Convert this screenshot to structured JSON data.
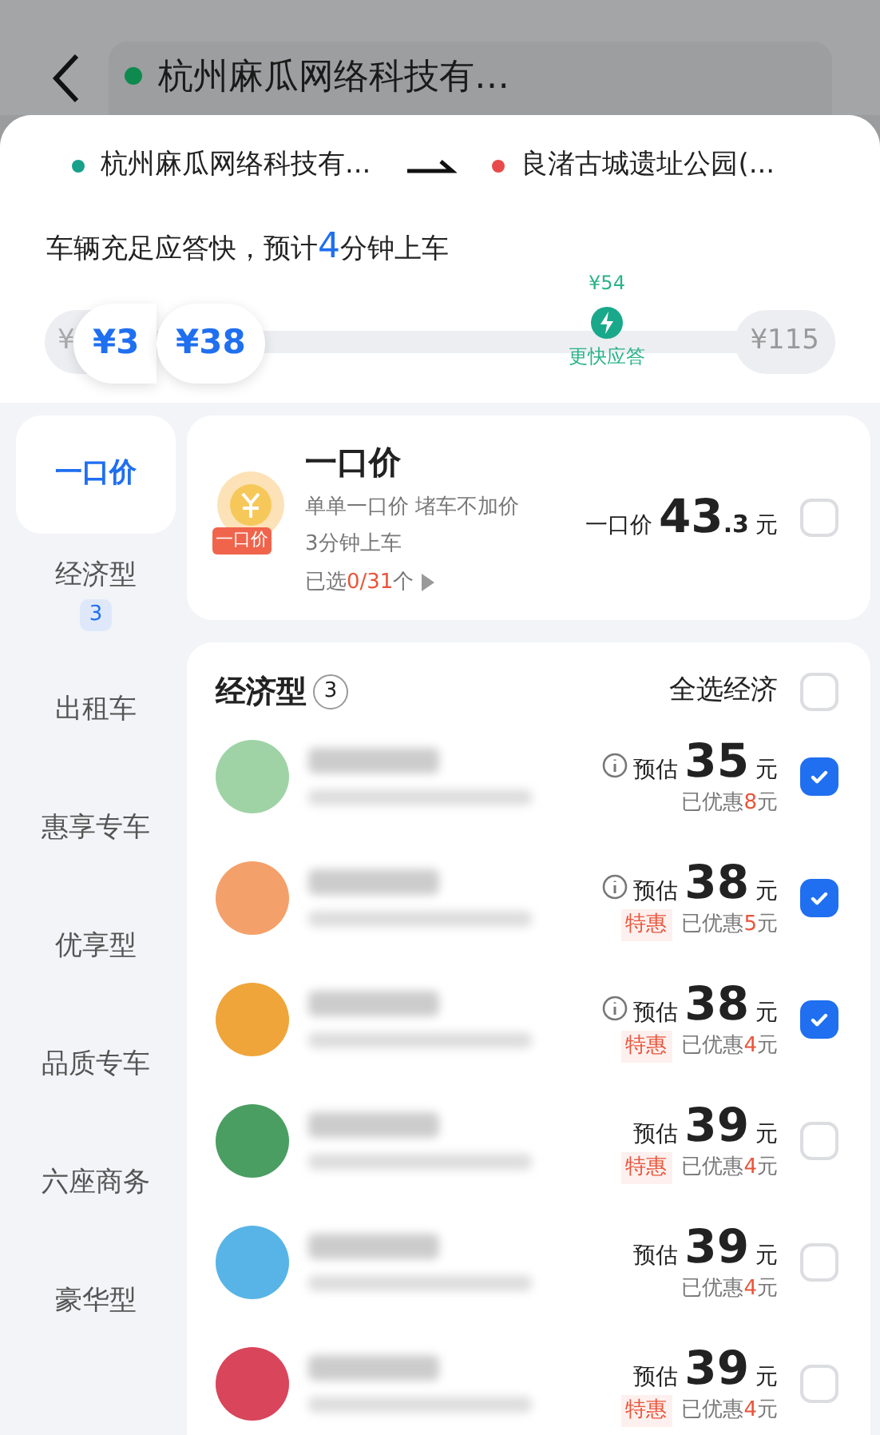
{
  "header": {
    "origin_field": "杭州麻瓜网络科技有…"
  },
  "route": {
    "from": "杭州麻瓜网络科技有...",
    "to": "良渚古城遗址公园(..."
  },
  "eta": {
    "before": "车辆充足应答快，预计",
    "minutes": "4",
    "after": "分钟上车"
  },
  "price_range": {
    "min_label": "¥",
    "selected": [
      "¥3",
      "¥38"
    ],
    "marker_price": "¥54",
    "marker_label": "更快应答",
    "max_label": "¥115"
  },
  "sidebar": {
    "items": [
      {
        "label": "一口价",
        "selected": true
      },
      {
        "label": "经济型",
        "selected": false,
        "badge": "3"
      },
      {
        "label": "出租车",
        "selected": false
      },
      {
        "label": "惠享专车",
        "selected": false
      },
      {
        "label": "优享型",
        "selected": false
      },
      {
        "label": "品质专车",
        "selected": false
      },
      {
        "label": "六座商务",
        "selected": false
      },
      {
        "label": "豪华型",
        "selected": false
      }
    ]
  },
  "fixed_price": {
    "title": "一口价",
    "badge": "一口价",
    "desc": "单单一口价 堵车不加价",
    "pickup": "3分钟上车",
    "selected_prefix": "已选",
    "selected_count": "0/31",
    "selected_suffix": "个",
    "price_label": "一口价",
    "price_int": "43",
    "price_dec": ".3",
    "unit": "元",
    "checked": false
  },
  "economy": {
    "title": "经济型",
    "count": "3",
    "select_all": "全选经济",
    "select_all_checked": false,
    "rows": [
      {
        "color": "#9fd3a6",
        "info_icon": true,
        "label": "预估",
        "price": "35",
        "unit": "元",
        "tag": null,
        "discount_prefix": "已优惠",
        "discount_amount": "8",
        "discount_unit": "元",
        "checked": true
      },
      {
        "color": "#f4a06a",
        "info_icon": true,
        "label": "预估",
        "price": "38",
        "unit": "元",
        "tag": "特惠",
        "discount_prefix": "已优惠",
        "discount_amount": "5",
        "discount_unit": "元",
        "checked": true
      },
      {
        "color": "#efa53a",
        "info_icon": true,
        "label": "预估",
        "price": "38",
        "unit": "元",
        "tag": "特惠",
        "discount_prefix": "已优惠",
        "discount_amount": "4",
        "discount_unit": "元",
        "checked": true
      },
      {
        "color": "#4a9e62",
        "info_icon": false,
        "label": "预估",
        "price": "39",
        "unit": "元",
        "tag": "特惠",
        "discount_prefix": "已优惠",
        "discount_amount": "4",
        "discount_unit": "元",
        "checked": false
      },
      {
        "color": "#58b4e6",
        "info_icon": false,
        "label": "预估",
        "price": "39",
        "unit": "元",
        "tag": null,
        "discount_prefix": "已优惠",
        "discount_amount": "4",
        "discount_unit": "元",
        "checked": false
      },
      {
        "color": "#d9455a",
        "info_icon": false,
        "label": "预估",
        "price": "39",
        "unit": "元",
        "tag": "特惠",
        "discount_prefix": "已优惠",
        "discount_amount": "4",
        "discount_unit": "元",
        "checked": false
      }
    ]
  }
}
